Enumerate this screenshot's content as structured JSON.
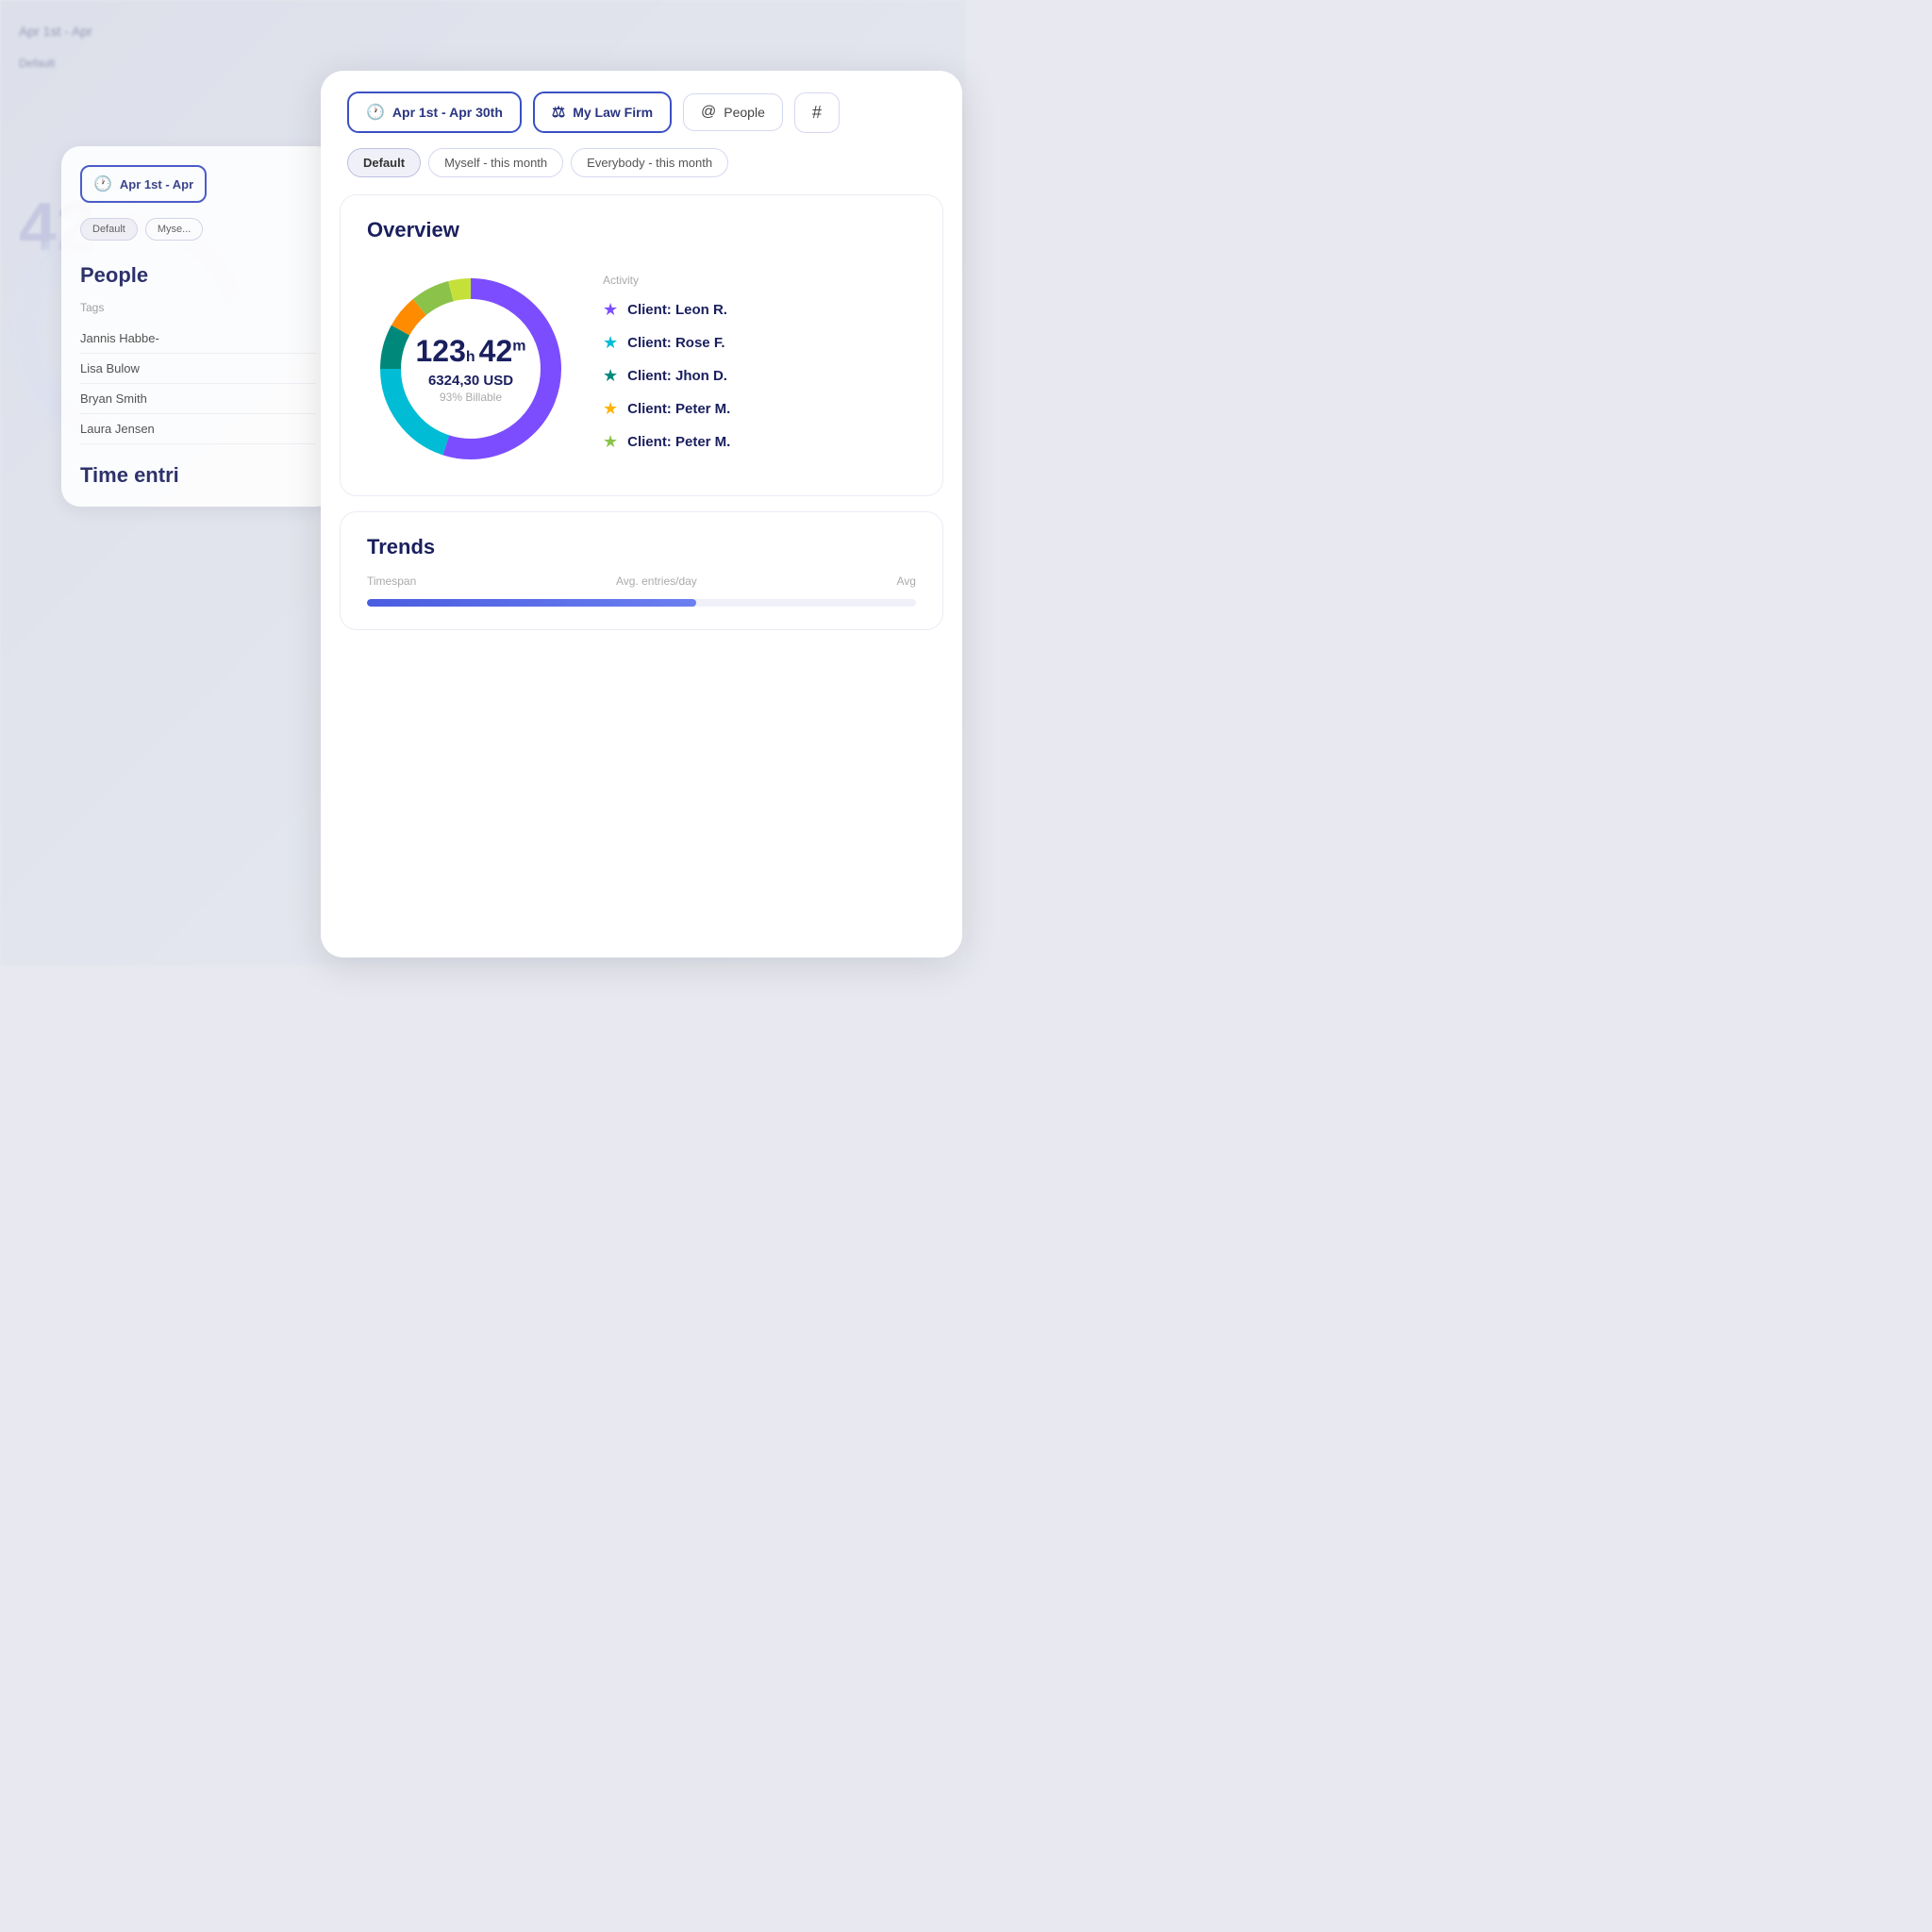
{
  "background": {
    "number": "42",
    "blurTexts": [
      "Apr 1st - Apr",
      "Default",
      "Myse"
    ]
  },
  "back_panel": {
    "date_range": "Apr 1st - Apr",
    "filters": [
      {
        "label": "Default",
        "active": true
      },
      {
        "label": "Myse..."
      }
    ],
    "people_section": {
      "title": "People",
      "tags_label": "Tags",
      "people": [
        {
          "name": "Jannis Habbe-"
        },
        {
          "name": "Lisa Bulow"
        },
        {
          "name": "Bryan Smith"
        },
        {
          "name": "Laura Jensen"
        }
      ]
    },
    "time_section": {
      "title": "Time entri"
    }
  },
  "main_panel": {
    "filter_buttons": [
      {
        "label": "Apr 1st - Apr 30th",
        "icon": "🕐",
        "type": "primary"
      },
      {
        "label": "My Law Firm",
        "icon": "⚖",
        "type": "primary"
      },
      {
        "label": "People",
        "icon": "@",
        "type": "ghost"
      },
      {
        "label": "#",
        "icon": "",
        "type": "hash"
      }
    ],
    "view_tabs": [
      {
        "label": "Default",
        "active": true
      },
      {
        "label": "Myself - this month",
        "active": false
      },
      {
        "label": "Everybody - this month",
        "active": false
      }
    ],
    "overview": {
      "title": "Overview",
      "hours": "123",
      "minutes": "42",
      "usd": "6324,30 USD",
      "billable": "93% Billable",
      "activity_label": "Activity",
      "activities": [
        {
          "name": "Client: Leon R.",
          "color": "#7c4dff",
          "star": "★"
        },
        {
          "name": "Client: Rose F.",
          "color": "#00bcd4",
          "star": "★"
        },
        {
          "name": "Client: Jhon D.",
          "color": "#00897b",
          "star": "★"
        },
        {
          "name": "Client: Peter M.",
          "color": "#ffb300",
          "star": "★"
        },
        {
          "name": "Client: Peter M.",
          "color": "#8bc34a",
          "star": "★"
        }
      ],
      "donut_segments": [
        {
          "label": "purple",
          "color": "#7c4dff",
          "offset": 0,
          "pct": 55
        },
        {
          "label": "cyan",
          "color": "#00bcd4",
          "offset": 55,
          "pct": 20
        },
        {
          "label": "teal",
          "color": "#00897b",
          "offset": 75,
          "pct": 8
        },
        {
          "label": "orange",
          "color": "#ff8c00",
          "offset": 83,
          "pct": 6
        },
        {
          "label": "green",
          "color": "#8bc34a",
          "offset": 89,
          "pct": 7
        },
        {
          "label": "lime",
          "color": "#c6e03a",
          "offset": 96,
          "pct": 4
        }
      ]
    },
    "trends": {
      "title": "Trends",
      "timespan_label": "Timespan",
      "avg_label": "Avg. entries/day",
      "avg2_label": "Avg"
    }
  }
}
